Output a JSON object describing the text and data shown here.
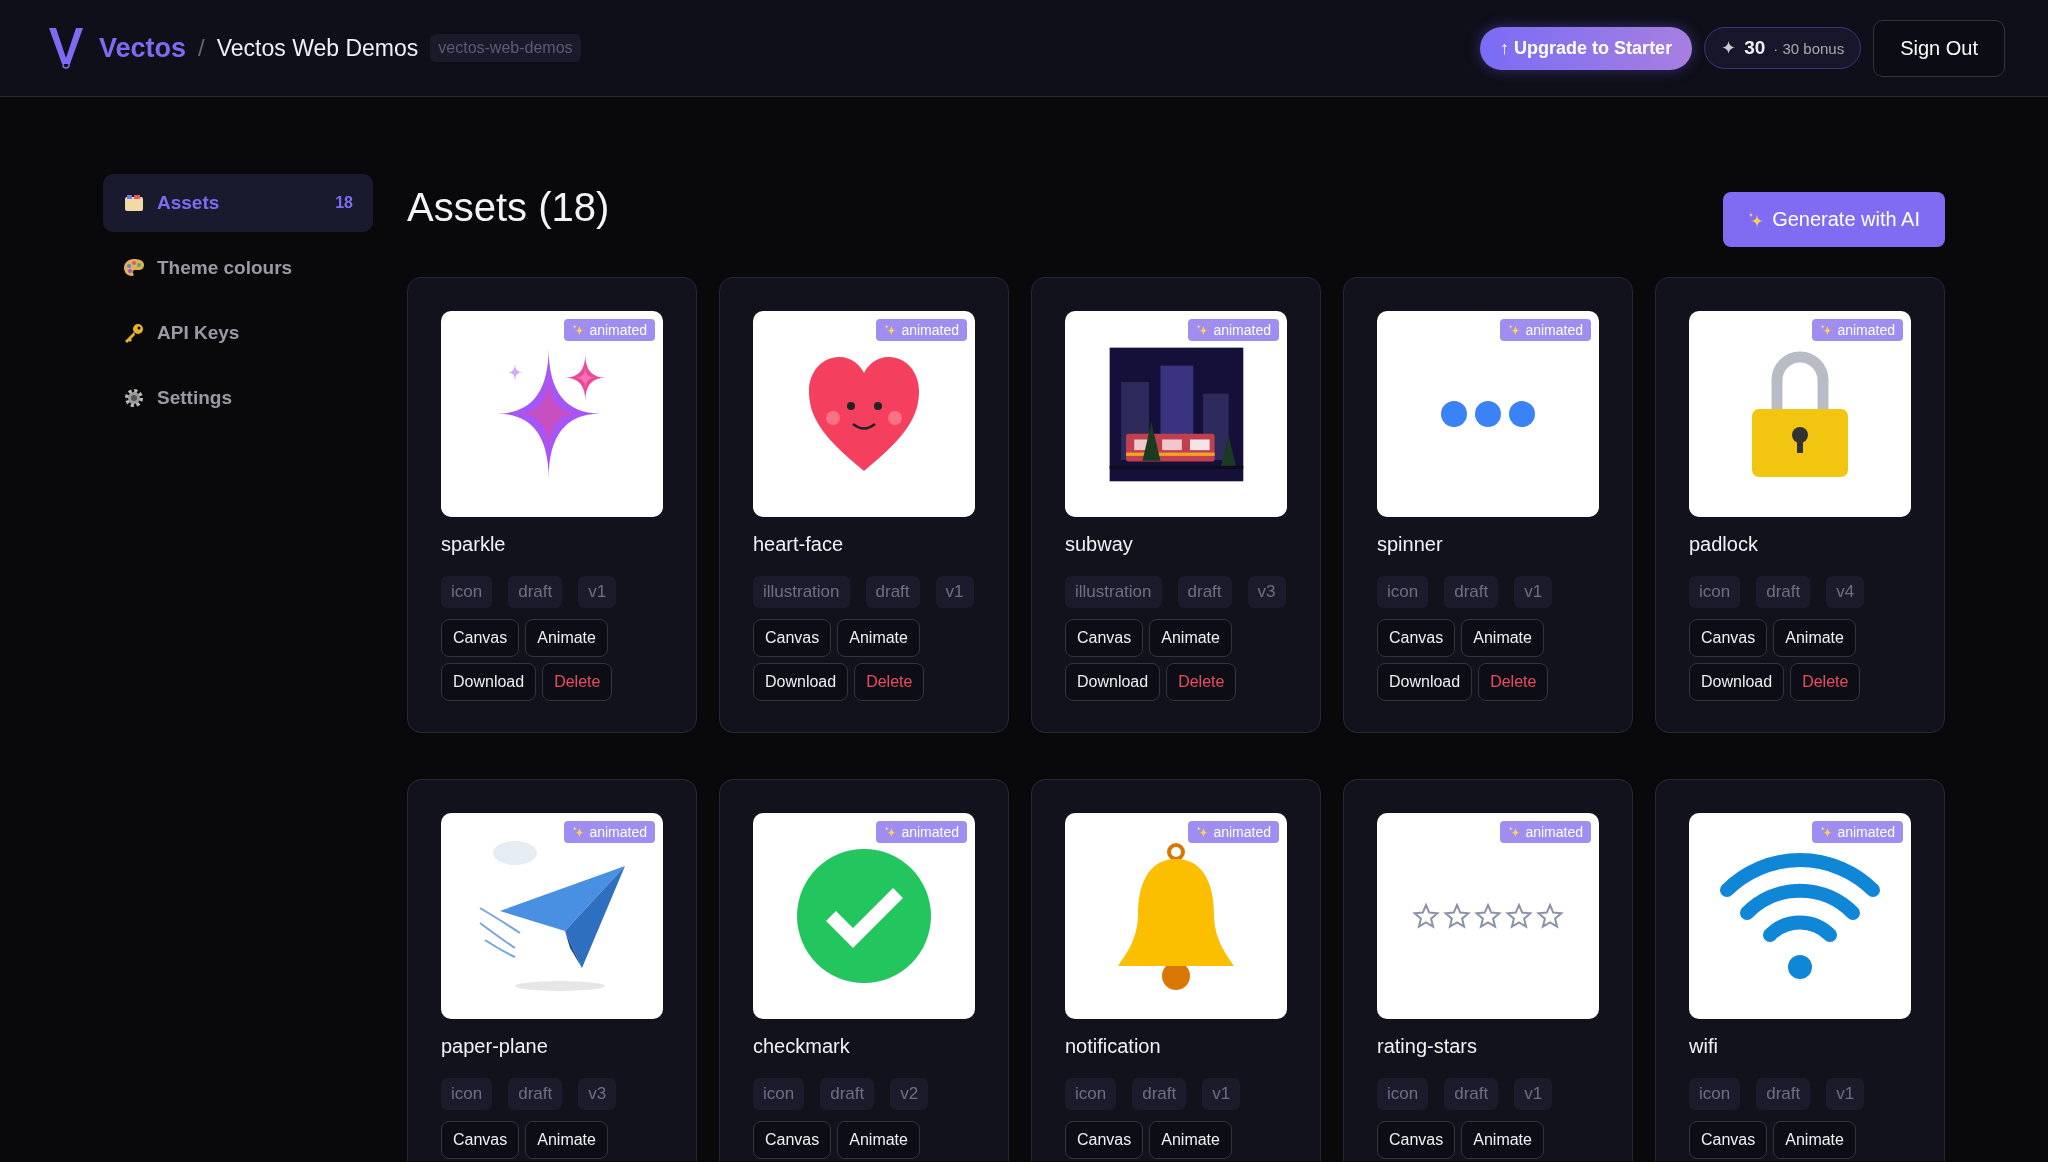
{
  "header": {
    "brand": "Vectos",
    "separator": "/",
    "project": "Vectos Web Demos",
    "slug": "vectos-web-demos",
    "upgrade": "↑ Upgrade to Starter",
    "credits": {
      "icon": "✦",
      "amount": "30",
      "bonus": "· 30 bonus"
    },
    "sign_out": "Sign Out"
  },
  "sidebar": {
    "items": [
      {
        "label": "Assets",
        "count": "18",
        "selected": true,
        "kind": "box"
      },
      {
        "label": "Theme colours",
        "selected": false,
        "kind": "palette"
      },
      {
        "label": "API Keys",
        "selected": false,
        "kind": "key"
      },
      {
        "label": "Settings",
        "selected": false,
        "kind": "gear"
      }
    ]
  },
  "page": {
    "title": "Assets (18)",
    "generate": "Generate with AI"
  },
  "assets": [
    {
      "name": "sparkle",
      "kind": "sparkle",
      "badge": "animated",
      "tags": [
        "icon",
        "draft",
        "v1"
      ],
      "buttons": [
        {
          "label": "Canvas",
          "kind": "normal"
        },
        {
          "label": "Animate",
          "kind": "normal"
        },
        {
          "label": "Download",
          "kind": "normal"
        },
        {
          "label": "Delete",
          "kind": "danger"
        }
      ]
    },
    {
      "name": "heart-face",
      "kind": "heart",
      "badge": "animated",
      "tags": [
        "illustration",
        "draft",
        "v1"
      ],
      "buttons": [
        {
          "label": "Canvas",
          "kind": "normal"
        },
        {
          "label": "Animate",
          "kind": "normal"
        },
        {
          "label": "Download",
          "kind": "normal"
        },
        {
          "label": "Delete",
          "kind": "danger"
        }
      ]
    },
    {
      "name": "subway",
      "kind": "subway",
      "badge": "animated",
      "tags": [
        "illustration",
        "draft",
        "v3"
      ],
      "buttons": [
        {
          "label": "Canvas",
          "kind": "normal"
        },
        {
          "label": "Animate",
          "kind": "normal"
        },
        {
          "label": "Download",
          "kind": "normal"
        },
        {
          "label": "Delete",
          "kind": "danger"
        }
      ]
    },
    {
      "name": "spinner",
      "kind": "dots",
      "badge": "animated",
      "tags": [
        "icon",
        "draft",
        "v1"
      ],
      "buttons": [
        {
          "label": "Canvas",
          "kind": "normal"
        },
        {
          "label": "Animate",
          "kind": "normal"
        },
        {
          "label": "Download",
          "kind": "normal"
        },
        {
          "label": "Delete",
          "kind": "danger"
        }
      ]
    },
    {
      "name": "padlock",
      "kind": "padlock",
      "badge": "animated",
      "tags": [
        "icon",
        "draft",
        "v4"
      ],
      "buttons": [
        {
          "label": "Canvas",
          "kind": "normal"
        },
        {
          "label": "Animate",
          "kind": "normal"
        },
        {
          "label": "Download",
          "kind": "normal"
        },
        {
          "label": "Delete",
          "kind": "danger"
        }
      ]
    },
    {
      "name": "paper-plane",
      "kind": "plane",
      "badge": "animated",
      "tags": [
        "icon",
        "draft",
        "v3"
      ],
      "buttons": [
        {
          "label": "Canvas",
          "kind": "normal"
        },
        {
          "label": "Animate",
          "kind": "normal"
        }
      ]
    },
    {
      "name": "checkmark",
      "kind": "check",
      "badge": "animated",
      "tags": [
        "icon",
        "draft",
        "v2"
      ],
      "buttons": [
        {
          "label": "Canvas",
          "kind": "normal"
        },
        {
          "label": "Animate",
          "kind": "normal"
        }
      ]
    },
    {
      "name": "notification",
      "kind": "bell",
      "badge": "animated",
      "tags": [
        "icon",
        "draft",
        "v1"
      ],
      "buttons": [
        {
          "label": "Canvas",
          "kind": "normal"
        },
        {
          "label": "Animate",
          "kind": "normal"
        }
      ]
    },
    {
      "name": "rating-stars",
      "kind": "stars",
      "badge": "animated",
      "tags": [
        "icon",
        "draft",
        "v1"
      ],
      "buttons": [
        {
          "label": "Canvas",
          "kind": "normal"
        },
        {
          "label": "Animate",
          "kind": "normal"
        }
      ]
    },
    {
      "name": "wifi",
      "kind": "wifi",
      "badge": "animated",
      "tags": [
        "icon",
        "draft",
        "v1"
      ],
      "buttons": [
        {
          "label": "Canvas",
          "kind": "normal"
        },
        {
          "label": "Animate",
          "kind": "normal"
        }
      ]
    }
  ]
}
